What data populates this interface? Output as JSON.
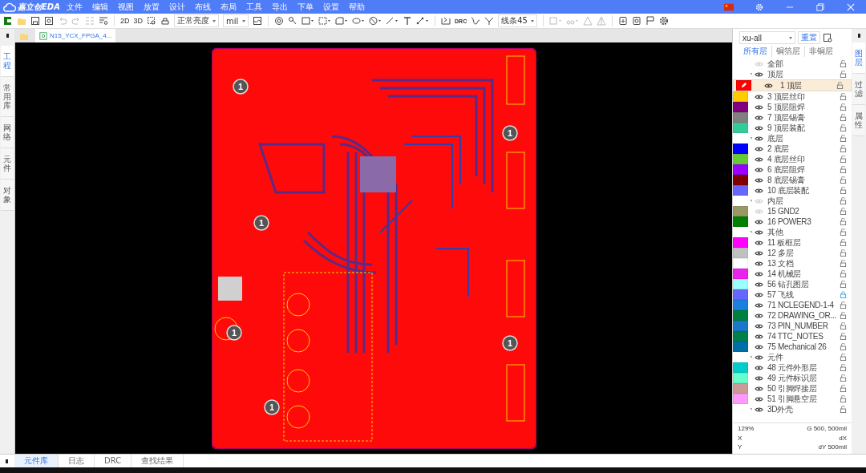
{
  "app": {
    "logo": "嘉立创EDA"
  },
  "menu": [
    "文件",
    "编辑",
    "视图",
    "放置",
    "设计",
    "布线",
    "布局",
    "工具",
    "导出",
    "下单",
    "设置",
    "帮助"
  ],
  "toolbar": {
    "undo": {
      "disabled": true
    },
    "redo": {
      "disabled": true
    },
    "view_2d": "2D",
    "view_3d": "3D",
    "brightness": "正常亮度",
    "unit": "mil",
    "drc": "DRC",
    "route_mode": "线条45"
  },
  "doc_tabs": [
    {
      "label": "N15_YCX_FPGA_4...",
      "selected": true
    }
  ],
  "left_tabs": [
    {
      "label": "工程",
      "selected": true
    },
    {
      "label": "常用库",
      "selected": false
    },
    {
      "label": "网络",
      "selected": false
    },
    {
      "label": "元件",
      "selected": false
    },
    {
      "label": "对象",
      "selected": false
    }
  ],
  "board": {
    "markers": [
      "1",
      "1",
      "1",
      "1",
      "1",
      "1"
    ]
  },
  "layer_panel": {
    "preset": "xu-all",
    "reset": "重置",
    "filters": [
      {
        "label": "所有层",
        "selected": true
      },
      {
        "label": "铜箔层",
        "selected": false
      },
      {
        "label": "非铜层",
        "selected": false
      }
    ],
    "layers": [
      {
        "kind": "all",
        "name": "全部",
        "visible": false
      },
      {
        "kind": "group",
        "name": "顶层",
        "visible": true,
        "expanded": true,
        "children": [
          {
            "name": "1 顶层",
            "color": "#ff0000",
            "visible": true,
            "locked": false,
            "selected": true
          },
          {
            "name": "3 顶层丝印",
            "color": "#ffcc00",
            "visible": true,
            "locked": false,
            "selected": false
          },
          {
            "name": "5 顶层阻焊",
            "color": "#800080",
            "visible": true,
            "locked": false,
            "selected": false
          },
          {
            "name": "7 顶层锡膏",
            "color": "#808080",
            "visible": true,
            "locked": false,
            "selected": false
          },
          {
            "name": "9 顶层装配",
            "color": "#33cc99",
            "visible": true,
            "locked": false,
            "selected": false
          }
        ]
      },
      {
        "kind": "group",
        "name": "底层",
        "visible": true,
        "expanded": true,
        "children": [
          {
            "name": "2 底层",
            "color": "#0000ff",
            "visible": true,
            "locked": false,
            "selected": false
          },
          {
            "name": "4 底层丝印",
            "color": "#66cc33",
            "visible": true,
            "locked": false,
            "selected": false
          },
          {
            "name": "6 底层阻焊",
            "color": "#9900ff",
            "visible": true,
            "locked": false,
            "selected": false
          },
          {
            "name": "8 底层锡膏",
            "color": "#800000",
            "visible": true,
            "locked": false,
            "selected": false
          },
          {
            "name": "10 底层装配",
            "color": "#6666ff",
            "visible": true,
            "locked": false,
            "selected": false
          }
        ]
      },
      {
        "kind": "group",
        "name": "内层",
        "visible": false,
        "expanded": true,
        "children": [
          {
            "name": "15 GND2",
            "color": "#999966",
            "visible": false,
            "locked": false,
            "selected": false
          },
          {
            "name": "16 POWER3",
            "color": "#008000",
            "visible": true,
            "locked": false,
            "selected": false
          }
        ]
      },
      {
        "kind": "group",
        "name": "其他",
        "visible": true,
        "expanded": true,
        "children": [
          {
            "name": "11 板框层",
            "color": "#ff00ff",
            "visible": true,
            "locked": false,
            "selected": false
          },
          {
            "name": "12 多层",
            "color": "#c0c0c0",
            "visible": true,
            "locked": false,
            "selected": false
          },
          {
            "name": "13 文档",
            "color": "#ffffff",
            "visible": true,
            "locked": false,
            "selected": false
          },
          {
            "name": "14 机械层",
            "color": "#ee22ee",
            "visible": true,
            "locked": false,
            "selected": false
          },
          {
            "name": "56 钻孔图层",
            "color": "#99ffff",
            "visible": true,
            "locked": false,
            "selected": false
          },
          {
            "name": "57 飞线",
            "color": "#6666ff",
            "visible": true,
            "locked": true,
            "selected": false
          },
          {
            "name": "71 NCLEGEND-1-4",
            "color": "#1a7fe0",
            "visible": true,
            "locked": false,
            "selected": false
          },
          {
            "name": "72 DRAWING_OR...",
            "color": "#008040",
            "visible": true,
            "locked": false,
            "selected": false
          },
          {
            "name": "73 PIN_NUMBER",
            "color": "#1a78c8",
            "visible": true,
            "locked": false,
            "selected": false
          },
          {
            "name": "74 TTC_NOTES",
            "color": "#00804a",
            "visible": true,
            "locked": false,
            "selected": false
          },
          {
            "name": "75 Mechanical 26",
            "color": "#006fa8",
            "visible": true,
            "locked": false,
            "selected": false
          }
        ]
      },
      {
        "kind": "group",
        "name": "元件",
        "visible": true,
        "expanded": true,
        "children": [
          {
            "name": "48 元件外形层",
            "color": "#00cccc",
            "visible": true,
            "locked": false,
            "selected": false
          },
          {
            "name": "49 元件标识层",
            "color": "#66ffcc",
            "visible": true,
            "locked": false,
            "selected": false
          },
          {
            "name": "50 引脚焊接层",
            "color": "#cc9999",
            "visible": true,
            "locked": false,
            "selected": false
          },
          {
            "name": "51 引脚悬空层",
            "color": "#ff99ff",
            "visible": true,
            "locked": false,
            "selected": false
          }
        ]
      },
      {
        "kind": "group",
        "name": "3D外壳",
        "visible": true,
        "expanded": true
      }
    ]
  },
  "status": {
    "zoom": "129%",
    "grid": "G",
    "grid_value": "500, 500mil",
    "x": "X",
    "dx": "dX",
    "y": "Y",
    "dy": "dY",
    "dy_value": "500mil"
  },
  "right_tabs": [
    {
      "label": "图层",
      "selected": true
    },
    {
      "label": "过滤",
      "selected": false
    },
    {
      "label": "属性",
      "selected": false
    }
  ],
  "bottom_tabs": [
    {
      "label": "元件库",
      "selected": true
    },
    {
      "label": "日志",
      "selected": false
    },
    {
      "label": "DRC",
      "selected": false
    },
    {
      "label": "查找结果",
      "selected": false
    }
  ]
}
